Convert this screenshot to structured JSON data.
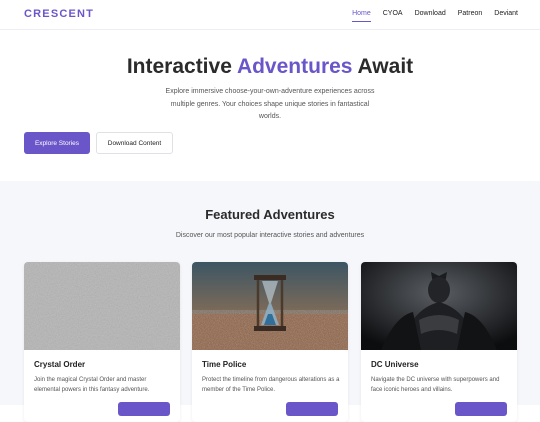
{
  "brand": {
    "logo": "CRESCENT",
    "accent": "#6b56c9"
  },
  "nav": {
    "items": [
      {
        "label": "Home",
        "active": true
      },
      {
        "label": "CYOA",
        "active": false
      },
      {
        "label": "Download",
        "active": false
      },
      {
        "label": "Patreon",
        "active": false
      },
      {
        "label": "Deviant",
        "active": false
      }
    ]
  },
  "hero": {
    "title_start": "Interactive ",
    "title_accent": "Adventures",
    "title_end": " Await",
    "subtitle": "Explore immersive choose-your-own-adventure experiences across multiple genres. Your choices shape unique stories in fantastical worlds.",
    "primary_button": "Explore Stories",
    "secondary_button": "Download Content"
  },
  "featured": {
    "title": "Featured Adventures",
    "subtitle": "Discover our most popular interactive stories and adventures",
    "cards": [
      {
        "title": "Crystal Order",
        "description": "Join the magical Crystal Order and master elemental powers in this fantasy adventure.",
        "image": "gray-texture-image"
      },
      {
        "title": "Time Police",
        "description": "Protect the timeline from dangerous alterations as a member of the Time Police.",
        "image": "hourglass-image"
      },
      {
        "title": "DC Universe",
        "description": "Navigate the DC universe with superpowers and face iconic heroes and villains.",
        "image": "dark-knight-image"
      }
    ]
  }
}
